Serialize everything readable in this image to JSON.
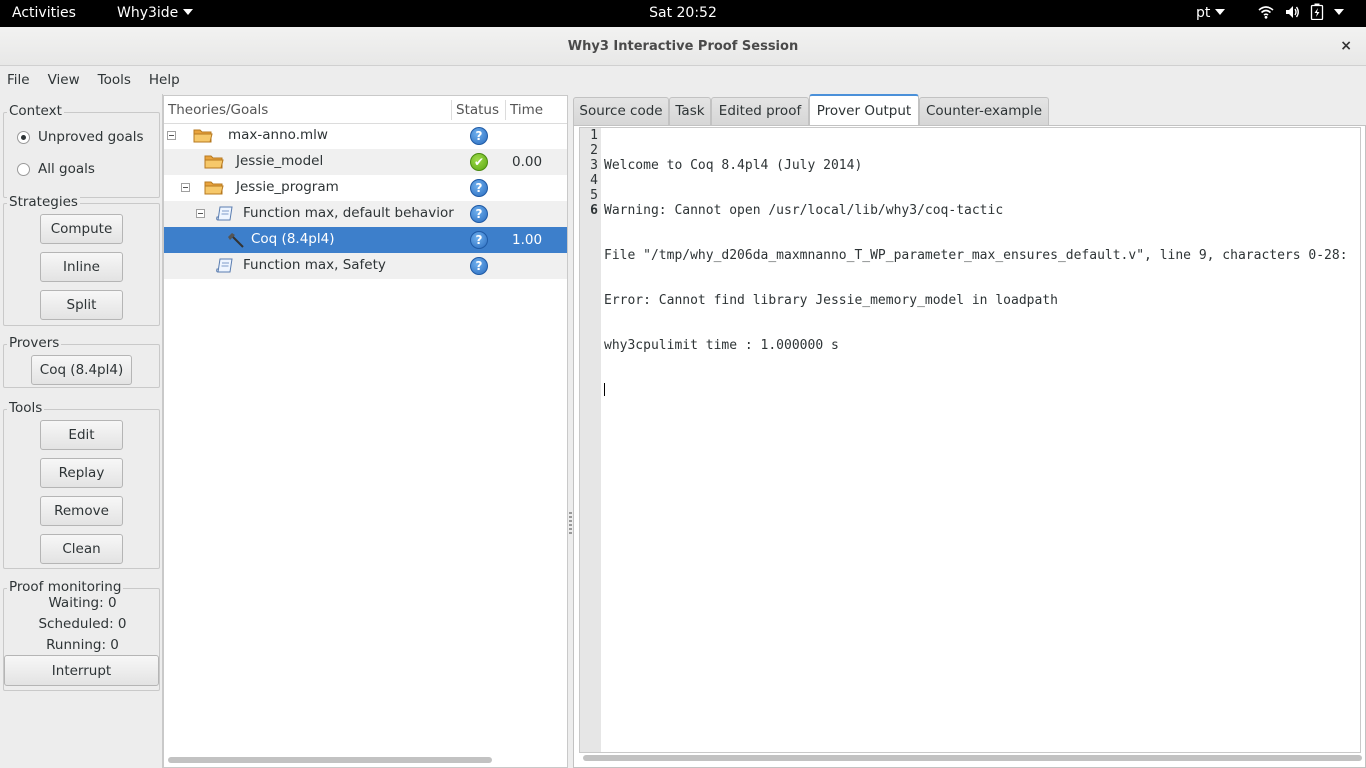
{
  "topbar": {
    "activities": "Activities",
    "app_menu": "Why3ide",
    "clock": "Sat 20:52",
    "language": "pt",
    "tray_icons": [
      "wifi-icon",
      "volume-icon",
      "battery-icon"
    ]
  },
  "window": {
    "title": "Why3 Interactive Proof Session",
    "close": "×"
  },
  "menubar": {
    "items": [
      "File",
      "View",
      "Tools",
      "Help"
    ]
  },
  "left": {
    "context": {
      "label": "Context",
      "options": [
        {
          "label": "Unproved goals",
          "selected": true
        },
        {
          "label": "All goals",
          "selected": false
        }
      ]
    },
    "strategies": {
      "label": "Strategies",
      "buttons": [
        "Compute",
        "Inline",
        "Split"
      ]
    },
    "provers": {
      "label": "Provers",
      "buttons": [
        "Coq (8.4pl4)"
      ]
    },
    "tools": {
      "label": "Tools",
      "buttons": [
        "Edit",
        "Replay",
        "Remove",
        "Clean"
      ]
    },
    "monitoring": {
      "label": "Proof monitoring",
      "waiting": "Waiting: 0",
      "scheduled": "Scheduled: 0",
      "running": "Running: 0",
      "interrupt": "Interrupt"
    }
  },
  "tree": {
    "headers": {
      "goals": "Theories/Goals",
      "status": "Status",
      "time": "Time"
    },
    "rows": [
      {
        "label": "max-anno.mlw",
        "status": "?",
        "time": ""
      },
      {
        "label": "Jessie_model",
        "status": "✔",
        "time": "0.00"
      },
      {
        "label": "Jessie_program",
        "status": "?",
        "time": ""
      },
      {
        "label": "Function max, default behavior",
        "status": "?",
        "time": ""
      },
      {
        "label": "Coq (8.4pl4)",
        "status": "?",
        "time": "1.00"
      },
      {
        "label": "Function max, Safety",
        "status": "?",
        "time": ""
      }
    ]
  },
  "tabs": [
    "Source code",
    "Task",
    "Edited proof",
    "Prover Output",
    "Counter-example"
  ],
  "editor": {
    "line_numbers": [
      "1",
      "2",
      "3",
      "4",
      "5",
      "6"
    ],
    "lines": [
      "Welcome to Coq 8.4pl4 (July 2014)",
      "Warning: Cannot open /usr/local/lib/why3/coq-tactic",
      "File \"/tmp/why_d206da_maxmnanno_T_WP_parameter_max_ensures_default.v\", line 9, characters 0-28:",
      "Error: Cannot find library Jessie_memory_model in loadpath",
      "why3cpulimit time : 1.000000 s",
      ""
    ]
  }
}
